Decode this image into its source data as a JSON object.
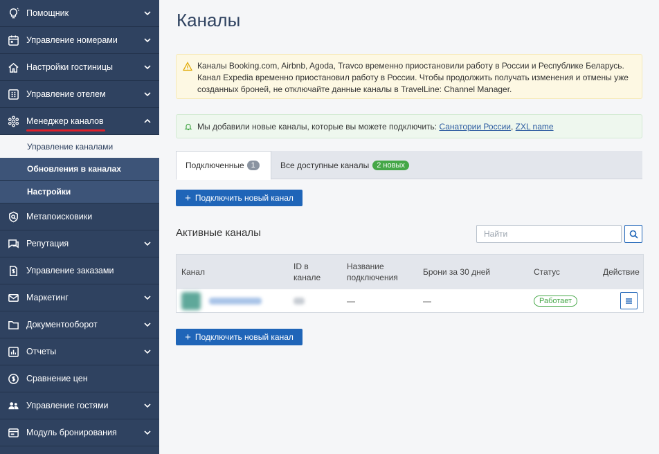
{
  "sidebar": {
    "items": [
      {
        "label": "Помощник",
        "icon": "lightbulb-icon"
      },
      {
        "label": "Управление номерами",
        "icon": "calendar-icon"
      },
      {
        "label": "Настройки гостиницы",
        "icon": "home-icon"
      },
      {
        "label": "Управление отелем",
        "icon": "grid-icon"
      },
      {
        "label": "Менеджер каналов",
        "icon": "hexagon-network-icon"
      },
      {
        "label": "Метапоисковики",
        "icon": "search-badge-icon"
      },
      {
        "label": "Репутация",
        "icon": "chat-icon"
      },
      {
        "label": "Управление заказами",
        "icon": "document-dollar-icon"
      },
      {
        "label": "Маркетинг",
        "icon": "envelope-icon"
      },
      {
        "label": "Документооборот",
        "icon": "folder-icon"
      },
      {
        "label": "Отчеты",
        "icon": "chart-icon"
      },
      {
        "label": "Сравнение цен",
        "icon": "price-compare-icon"
      },
      {
        "label": "Управление гостями",
        "icon": "users-icon"
      },
      {
        "label": "Модуль бронирования",
        "icon": "booking-module-icon"
      }
    ],
    "submenu": [
      "Управление каналами",
      "Обновления в каналах",
      "Настройки"
    ]
  },
  "page": {
    "title": "Каналы",
    "warning_text": "Каналы Booking.com, Airbnb, Agoda, Travco временно приостановили работу в России и Республике Беларусь. Канал Expedia временно приостановил работу в России. Чтобы продолжить получать изменения и отмены уже созданных броней, не отключайте данные каналы в TravelLine: Channel Manager.",
    "info_text": "Мы добавили новые каналы, которые вы можете подключить: ",
    "info_link_1": "Санатории России",
    "info_separator": ", ",
    "info_link_2": "ZXL name"
  },
  "tabs": [
    {
      "label": "Подключенные",
      "badge": "1"
    },
    {
      "label": "Все доступные каналы",
      "badge": "2 новых"
    }
  ],
  "connect_button": {
    "plus": "+",
    "label": "Подключить новый канал"
  },
  "active_channels": {
    "title": "Активные каналы",
    "search_placeholder": "Найти",
    "columns": [
      "Канал",
      "ID в канале",
      "Название подключения",
      "Брони за 30 дней",
      "Статус",
      "Действие"
    ],
    "rows": [
      {
        "connection_name": "—",
        "bookings_30_days": "—",
        "status": "Работает"
      }
    ]
  },
  "colors": {
    "sidebar_bg": "#2f4260",
    "accent_blue": "#1f65b8",
    "status_green": "#45a747",
    "active_underline": "#e0202a"
  }
}
